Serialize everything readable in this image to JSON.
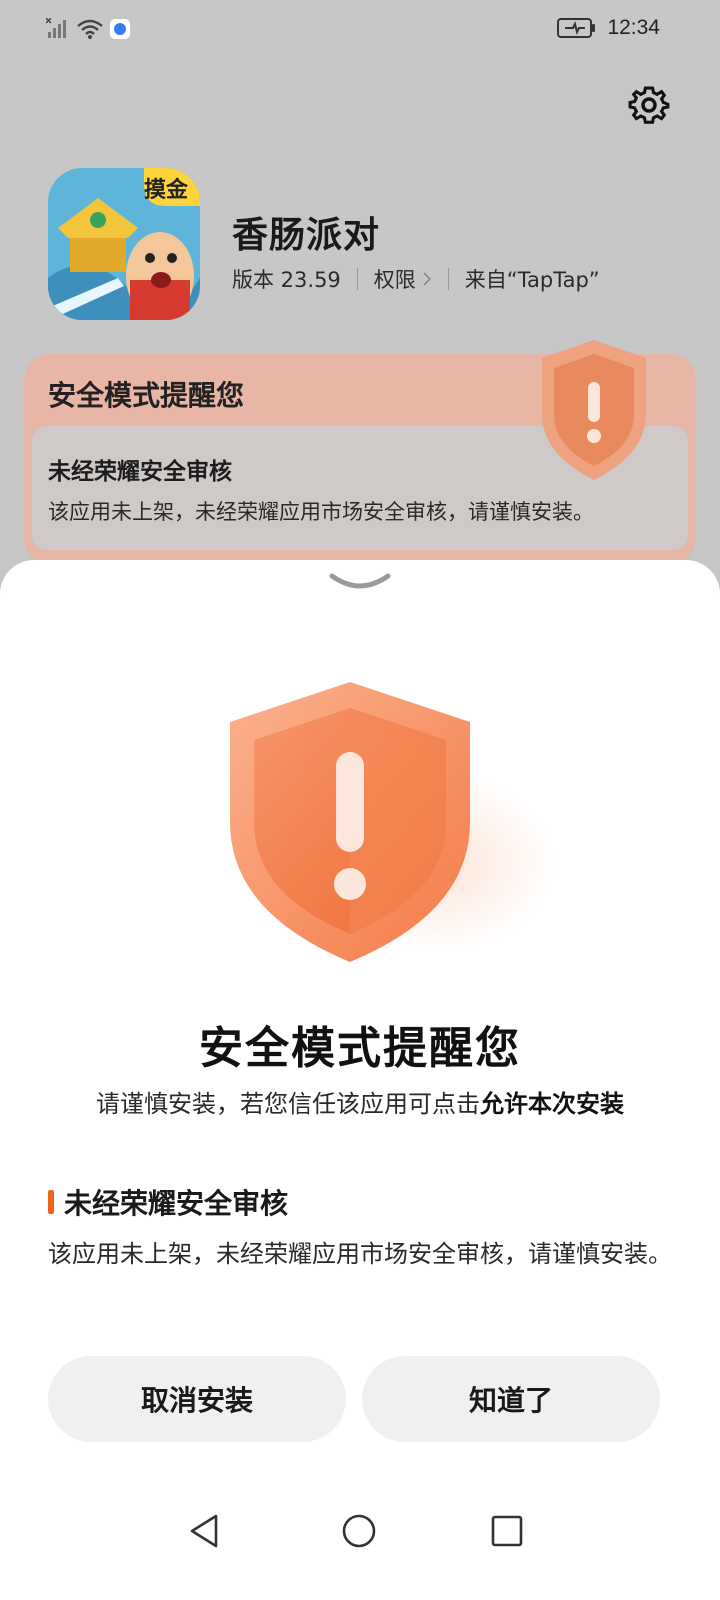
{
  "status_bar": {
    "time": "12:34",
    "icons": [
      "signal-icon",
      "wifi-icon",
      "app-notification-icon",
      "battery-charging-icon"
    ]
  },
  "header": {
    "settings_icon": "gear-icon"
  },
  "app": {
    "name": "香肠派对",
    "icon_badge": "摸金",
    "version": "版本 23.59",
    "permissions": "权限",
    "source": "来自“TapTap”"
  },
  "background_card": {
    "title": "安全模式提醒您",
    "subtitle": "未经荣耀安全审核",
    "description": "该应用未上架，未经荣耀应用市场安全审核，请谨慎安装。"
  },
  "sheet": {
    "title": "安全模式提醒您",
    "description_prefix": "请谨慎安装，若您信任该应用可点击",
    "description_highlight": "允许本次安装",
    "reason_title": "未经荣耀安全审核",
    "reason_description": "该应用未上架，未经荣耀应用市场安全审核，请谨慎安装。",
    "cancel_button": "取消安装",
    "ok_button": "知道了"
  },
  "colors": {
    "accent": "#f0641e",
    "shield_orange": "#f59a6e",
    "card_bg": "#e8b6a4"
  }
}
